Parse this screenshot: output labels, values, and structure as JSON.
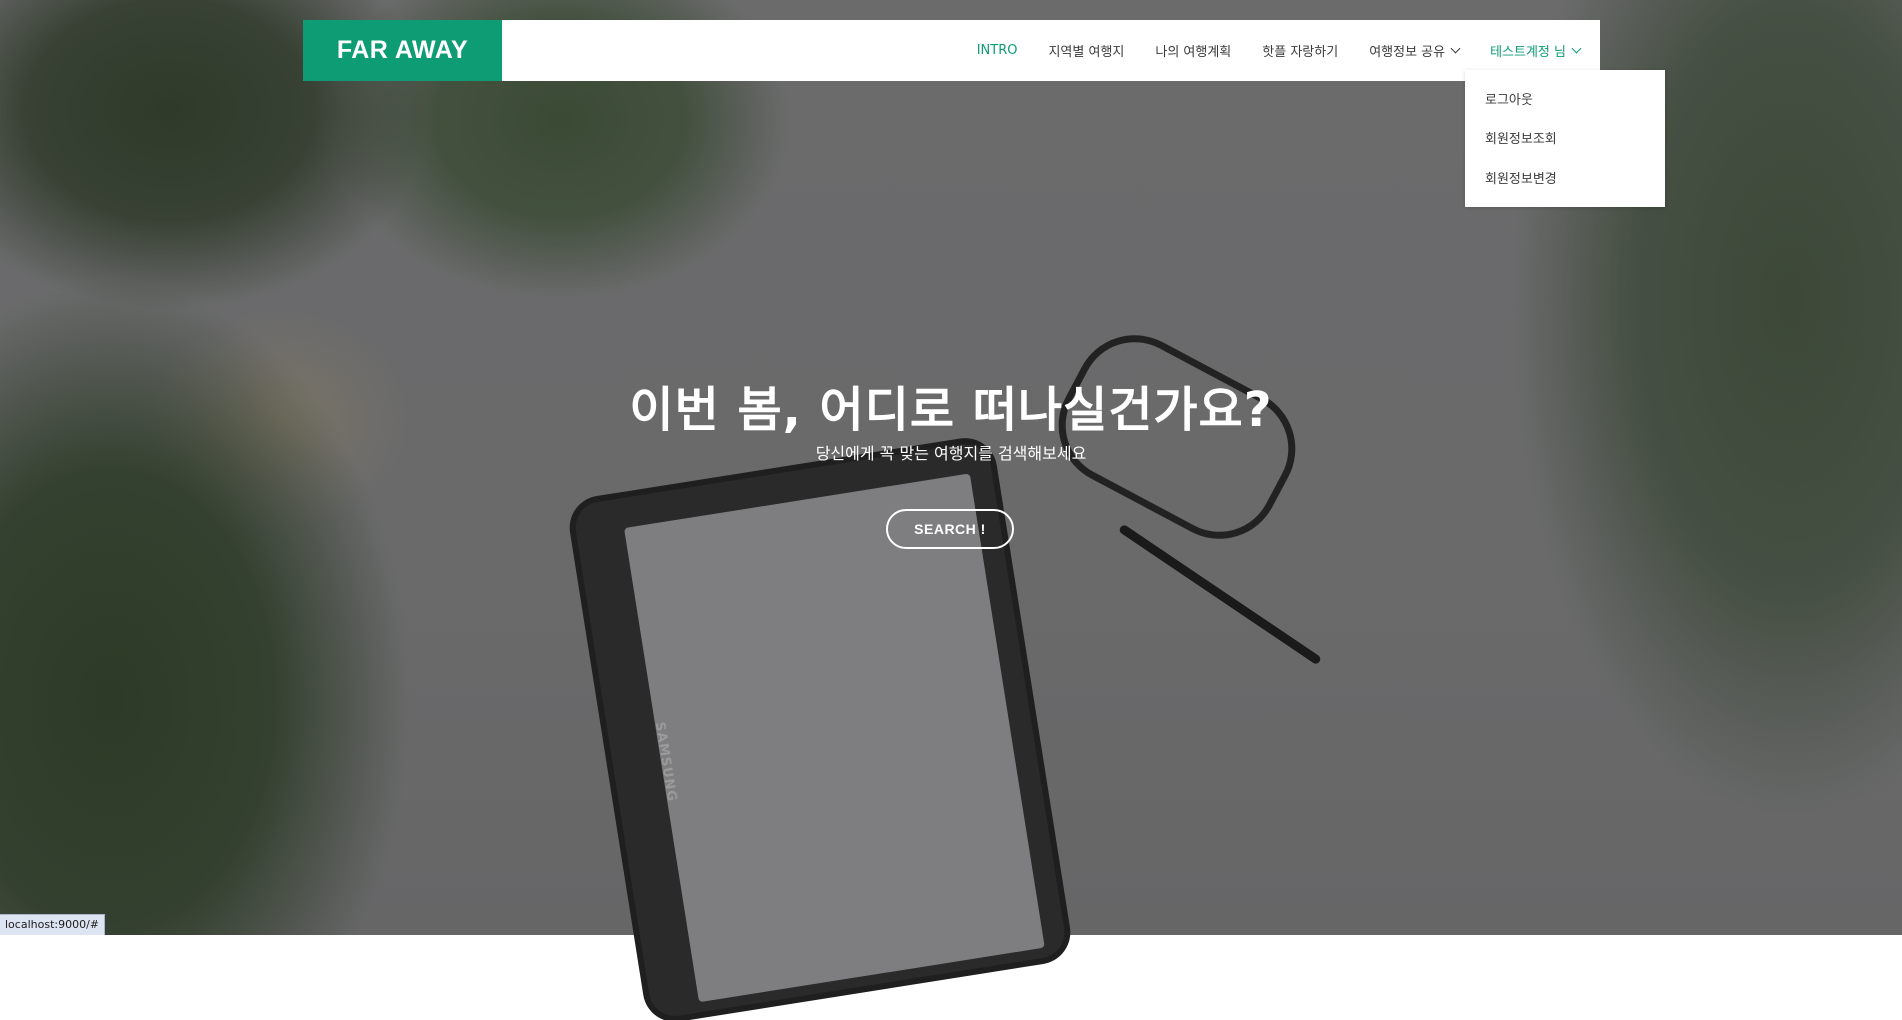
{
  "brand": {
    "logo": "FAR AWAY",
    "accent": "#0e9c74"
  },
  "nav": {
    "items": [
      {
        "label": "INTRO",
        "active": true,
        "dropdown": false
      },
      {
        "label": "지역별 여행지",
        "active": false,
        "dropdown": false
      },
      {
        "label": "나의 여행계획",
        "active": false,
        "dropdown": false
      },
      {
        "label": "핫플 자랑하기",
        "active": false,
        "dropdown": false
      },
      {
        "label": "여행정보 공유",
        "active": false,
        "dropdown": true
      },
      {
        "label": "테스트계정 님",
        "active": true,
        "dropdown": true
      }
    ],
    "user_menu": [
      "로그아웃",
      "회원정보조회",
      "회원정보변경"
    ]
  },
  "hero": {
    "title": "이번 봄, 어디로 떠나실건가요?",
    "subtitle": "당신에게 꼭 맞는 여행지를 검색해보세요",
    "button": "SEARCH !",
    "tablet_brand": "SAMSUNG"
  },
  "status_bar": {
    "url": "localhost:9000/#"
  }
}
